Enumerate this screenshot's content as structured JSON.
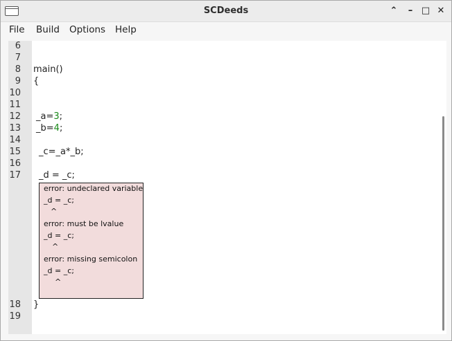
{
  "window": {
    "title": "SCDeeds",
    "controls": {
      "minimize_label": "⌃",
      "restore_label": "–",
      "maximize_label": "□",
      "close_label": "✕"
    }
  },
  "menu": {
    "items": [
      {
        "label": "File"
      },
      {
        "label": "Build"
      },
      {
        "label": "Options"
      },
      {
        "label": "Help"
      }
    ]
  },
  "editor": {
    "line_numbers": [
      "6",
      "7",
      "8",
      "9",
      "10",
      "11",
      "12",
      "13",
      "14",
      "15",
      "16",
      "17",
      "18",
      "19"
    ],
    "code": {
      "line8": "main()",
      "line9": "{",
      "line12_var": "_a=",
      "line12_num": "3",
      "line12_end": ";",
      "line13_var": "_b=",
      "line13_num": "4",
      "line13_end": ";",
      "line15": "_c=_a*_b;",
      "line17": "_d = _c;",
      "line18": "}"
    },
    "errors": [
      {
        "message": "error: undeclared variable",
        "code": "_d = _c;",
        "caret": "^"
      },
      {
        "message": "error: must be lvalue",
        "code": "_d = _c;",
        "caret": "^"
      },
      {
        "message": "error: missing semicolon",
        "code": "_d = _c;",
        "caret": "^"
      }
    ]
  }
}
